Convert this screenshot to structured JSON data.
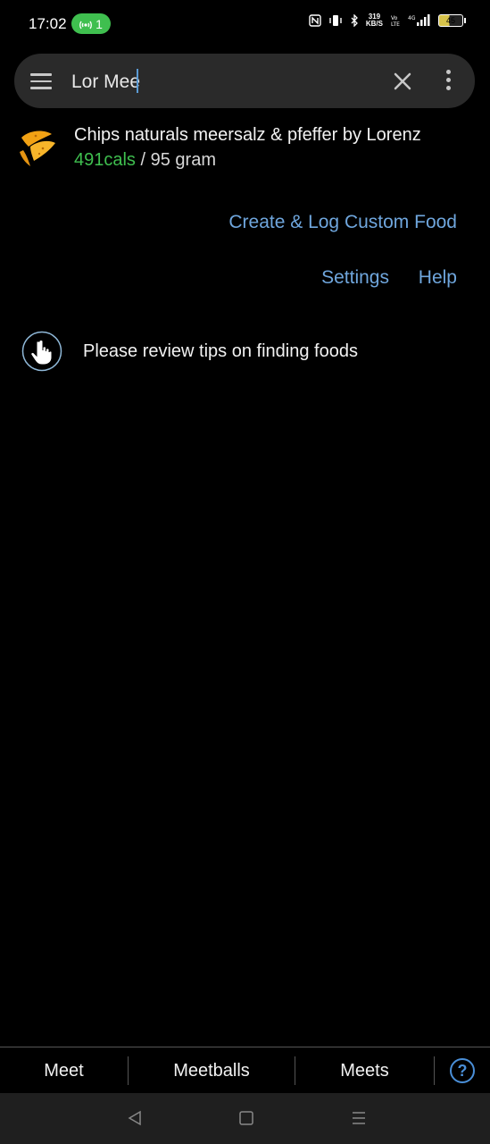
{
  "status_bar": {
    "time": "17:02",
    "hotspot_count": "1",
    "net_speed_value": "319",
    "net_speed_unit": "KB/S",
    "battery": "45",
    "icons": [
      "nfc-icon",
      "vibrate-icon",
      "bluetooth-icon",
      "volte-icon",
      "signal-4g-icon",
      "battery-icon"
    ]
  },
  "search": {
    "query": "Lor Mee",
    "menu_icon": "hamburger-menu-icon",
    "clear_icon": "close-icon",
    "more_icon": "more-vert-icon"
  },
  "results": [
    {
      "name": "Chips naturals meersalz & pfeffer by Lorenz",
      "cals": "491cals",
      "separator": " / ",
      "serving": "95 gram",
      "icon": "chips-icon"
    }
  ],
  "actions": {
    "create_custom": "Create & Log Custom Food",
    "settings": "Settings",
    "help": "Help"
  },
  "tip": {
    "text": "Please review tips on finding foods",
    "icon": "pointing-hand-icon"
  },
  "suggestions": [
    "Meet",
    "Meetballs",
    "Meets"
  ],
  "suggestion_help_icon": "question-circle-icon",
  "nav": {
    "back_icon": "back-triangle-icon",
    "home_icon": "home-square-icon",
    "recents_icon": "recents-menu-icon"
  },
  "colors": {
    "background": "#000000",
    "accent_link": "#6fa6dd",
    "calories_green": "#3fbf4f",
    "search_bg": "#2a2a2a",
    "nav_bg": "#1f1f1f"
  }
}
